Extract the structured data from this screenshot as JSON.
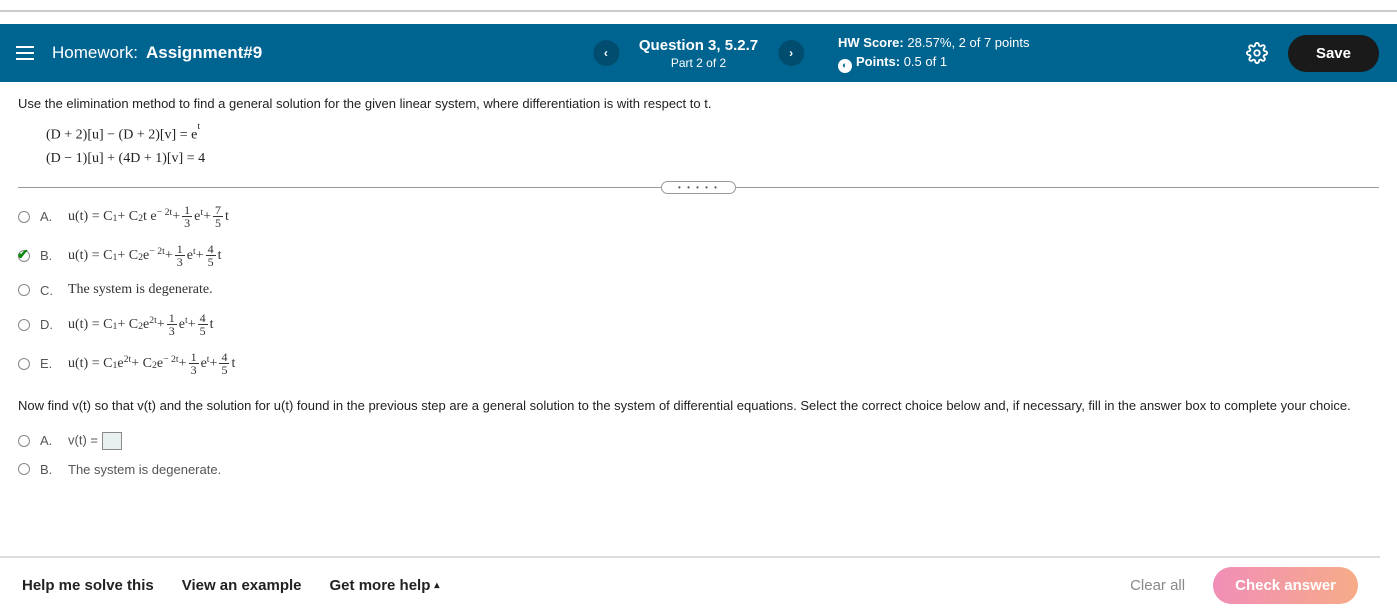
{
  "header": {
    "hw_label": "Homework:",
    "hw_name": "Assignment#9",
    "question_title": "Question 3, 5.2.7",
    "question_part": "Part 2 of 2",
    "score_label": "HW Score:",
    "score_value": "28.57%, 2 of 7 points",
    "points_label": "Points:",
    "points_value": "0.5 of 1",
    "save_label": "Save"
  },
  "prompt": "Use the elimination method to find a general solution for the given linear system, where differentiation is with respect to t.",
  "equations": {
    "line1": "(D + 2)[u] − (D + 2)[v]  =  e",
    "line1_sup": "t",
    "line2": "(D − 1)[u] + (4D + 1)[v]  =  4"
  },
  "choices": [
    {
      "letter": "A.",
      "pre": "u(t) = C",
      "sub1": "1",
      "mid1": " + C",
      "sub2": "2",
      "mid2": "t e",
      "exp": " − 2t",
      "plus1": " + ",
      "num1": "1",
      "den1": "3",
      "et": " e",
      "etexp": "t",
      "plus2": " + ",
      "num2": "7",
      "den2": "5",
      "tail": "t"
    },
    {
      "letter": "B.",
      "pre": "u(t) = C",
      "sub1": "1",
      "mid1": " + C",
      "sub2": "2",
      "mid2": " e",
      "exp": " − 2t",
      "plus1": " + ",
      "num1": "1",
      "den1": "3",
      "et": " e",
      "etexp": "t",
      "plus2": " + ",
      "num2": "4",
      "den2": "5",
      "tail": "t"
    },
    {
      "letter": "C.",
      "text": "The system is degenerate."
    },
    {
      "letter": "D.",
      "pre": "u(t) = C",
      "sub1": "1",
      "mid1": " + C",
      "sub2": "2",
      "mid2": " e",
      "exp": " 2t",
      "plus1": " + ",
      "num1": "1",
      "den1": "3",
      "et": " e",
      "etexp": "t",
      "plus2": " + ",
      "num2": "4",
      "den2": "5",
      "tail": "t"
    },
    {
      "letter": "E.",
      "pre": "u(t) = C",
      "sub1": "1",
      "mid0e": " e",
      "exp0": " 2t",
      "mid1": " + C",
      "sub2": "2",
      "mid2": " e",
      "exp": " − 2t",
      "plus1": " + ",
      "num1": "1",
      "den1": "3",
      "et": " e",
      "etexp": "t",
      "plus2": " + ",
      "num2": "4",
      "den2": "5",
      "tail": "t"
    }
  ],
  "selected_choice": 1,
  "v_prompt": "Now find v(t) so that v(t) and the solution for u(t) found in the previous step are a general solution to the system of differential equations. Select the correct choice below and, if necessary, fill in the answer box to complete your choice.",
  "v_choices": [
    {
      "letter": "A.",
      "text": "v(t) = ",
      "has_box": true
    },
    {
      "letter": "B.",
      "text": "The system is degenerate."
    }
  ],
  "footer": {
    "help": "Help me solve this",
    "example": "View an example",
    "more": "Get more help",
    "clear": "Clear all",
    "check": "Check answer"
  }
}
